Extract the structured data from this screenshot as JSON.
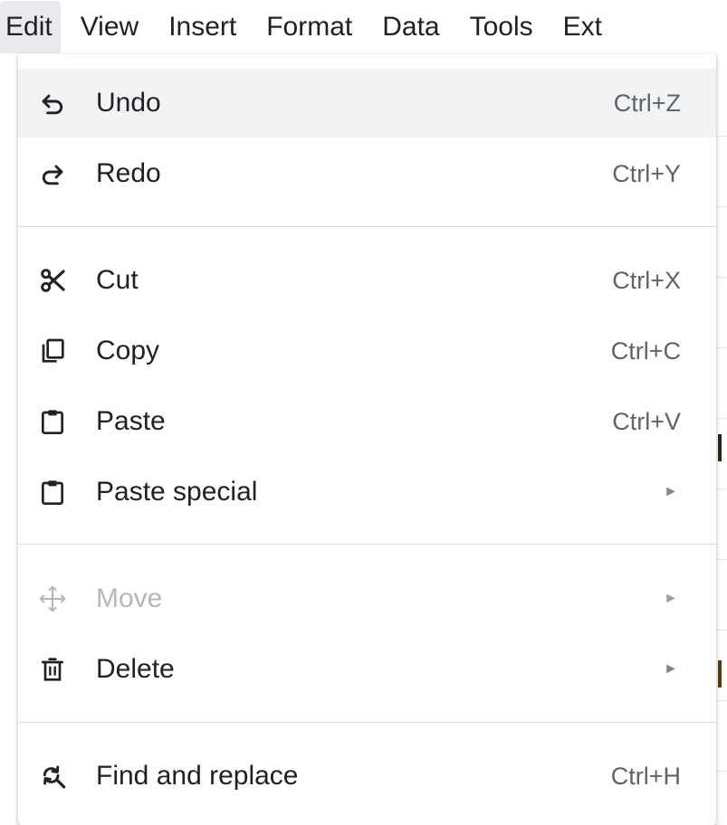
{
  "menubar": {
    "items": [
      {
        "label": "Edit"
      },
      {
        "label": "View"
      },
      {
        "label": "Insert"
      },
      {
        "label": "Format"
      },
      {
        "label": "Data"
      },
      {
        "label": "Tools"
      },
      {
        "label": "Ext"
      }
    ]
  },
  "edit_menu": {
    "undo": {
      "label": "Undo",
      "shortcut": "Ctrl+Z",
      "icon": "undo-icon"
    },
    "redo": {
      "label": "Redo",
      "shortcut": "Ctrl+Y",
      "icon": "redo-icon"
    },
    "cut": {
      "label": "Cut",
      "shortcut": "Ctrl+X",
      "icon": "scissors-icon"
    },
    "copy": {
      "label": "Copy",
      "shortcut": "Ctrl+C",
      "icon": "copy-icon"
    },
    "paste": {
      "label": "Paste",
      "shortcut": "Ctrl+V",
      "icon": "clipboard-icon"
    },
    "paste_special": {
      "label": "Paste special",
      "submenu": "►",
      "icon": "clipboard-icon"
    },
    "move": {
      "label": "Move",
      "submenu": "►",
      "icon": "move-icon",
      "disabled": true
    },
    "delete": {
      "label": "Delete",
      "submenu": "►",
      "icon": "trash-icon"
    },
    "find_replace": {
      "label": "Find and replace",
      "shortcut": "Ctrl+H",
      "icon": "find-replace-icon"
    }
  },
  "colors": {
    "text": "#202124",
    "shortcut": "#5f6368",
    "disabled": "#b4b7bb",
    "hover": "#f1f3f4",
    "separator": "#dadce0",
    "active_menu": "#e8eaed"
  }
}
